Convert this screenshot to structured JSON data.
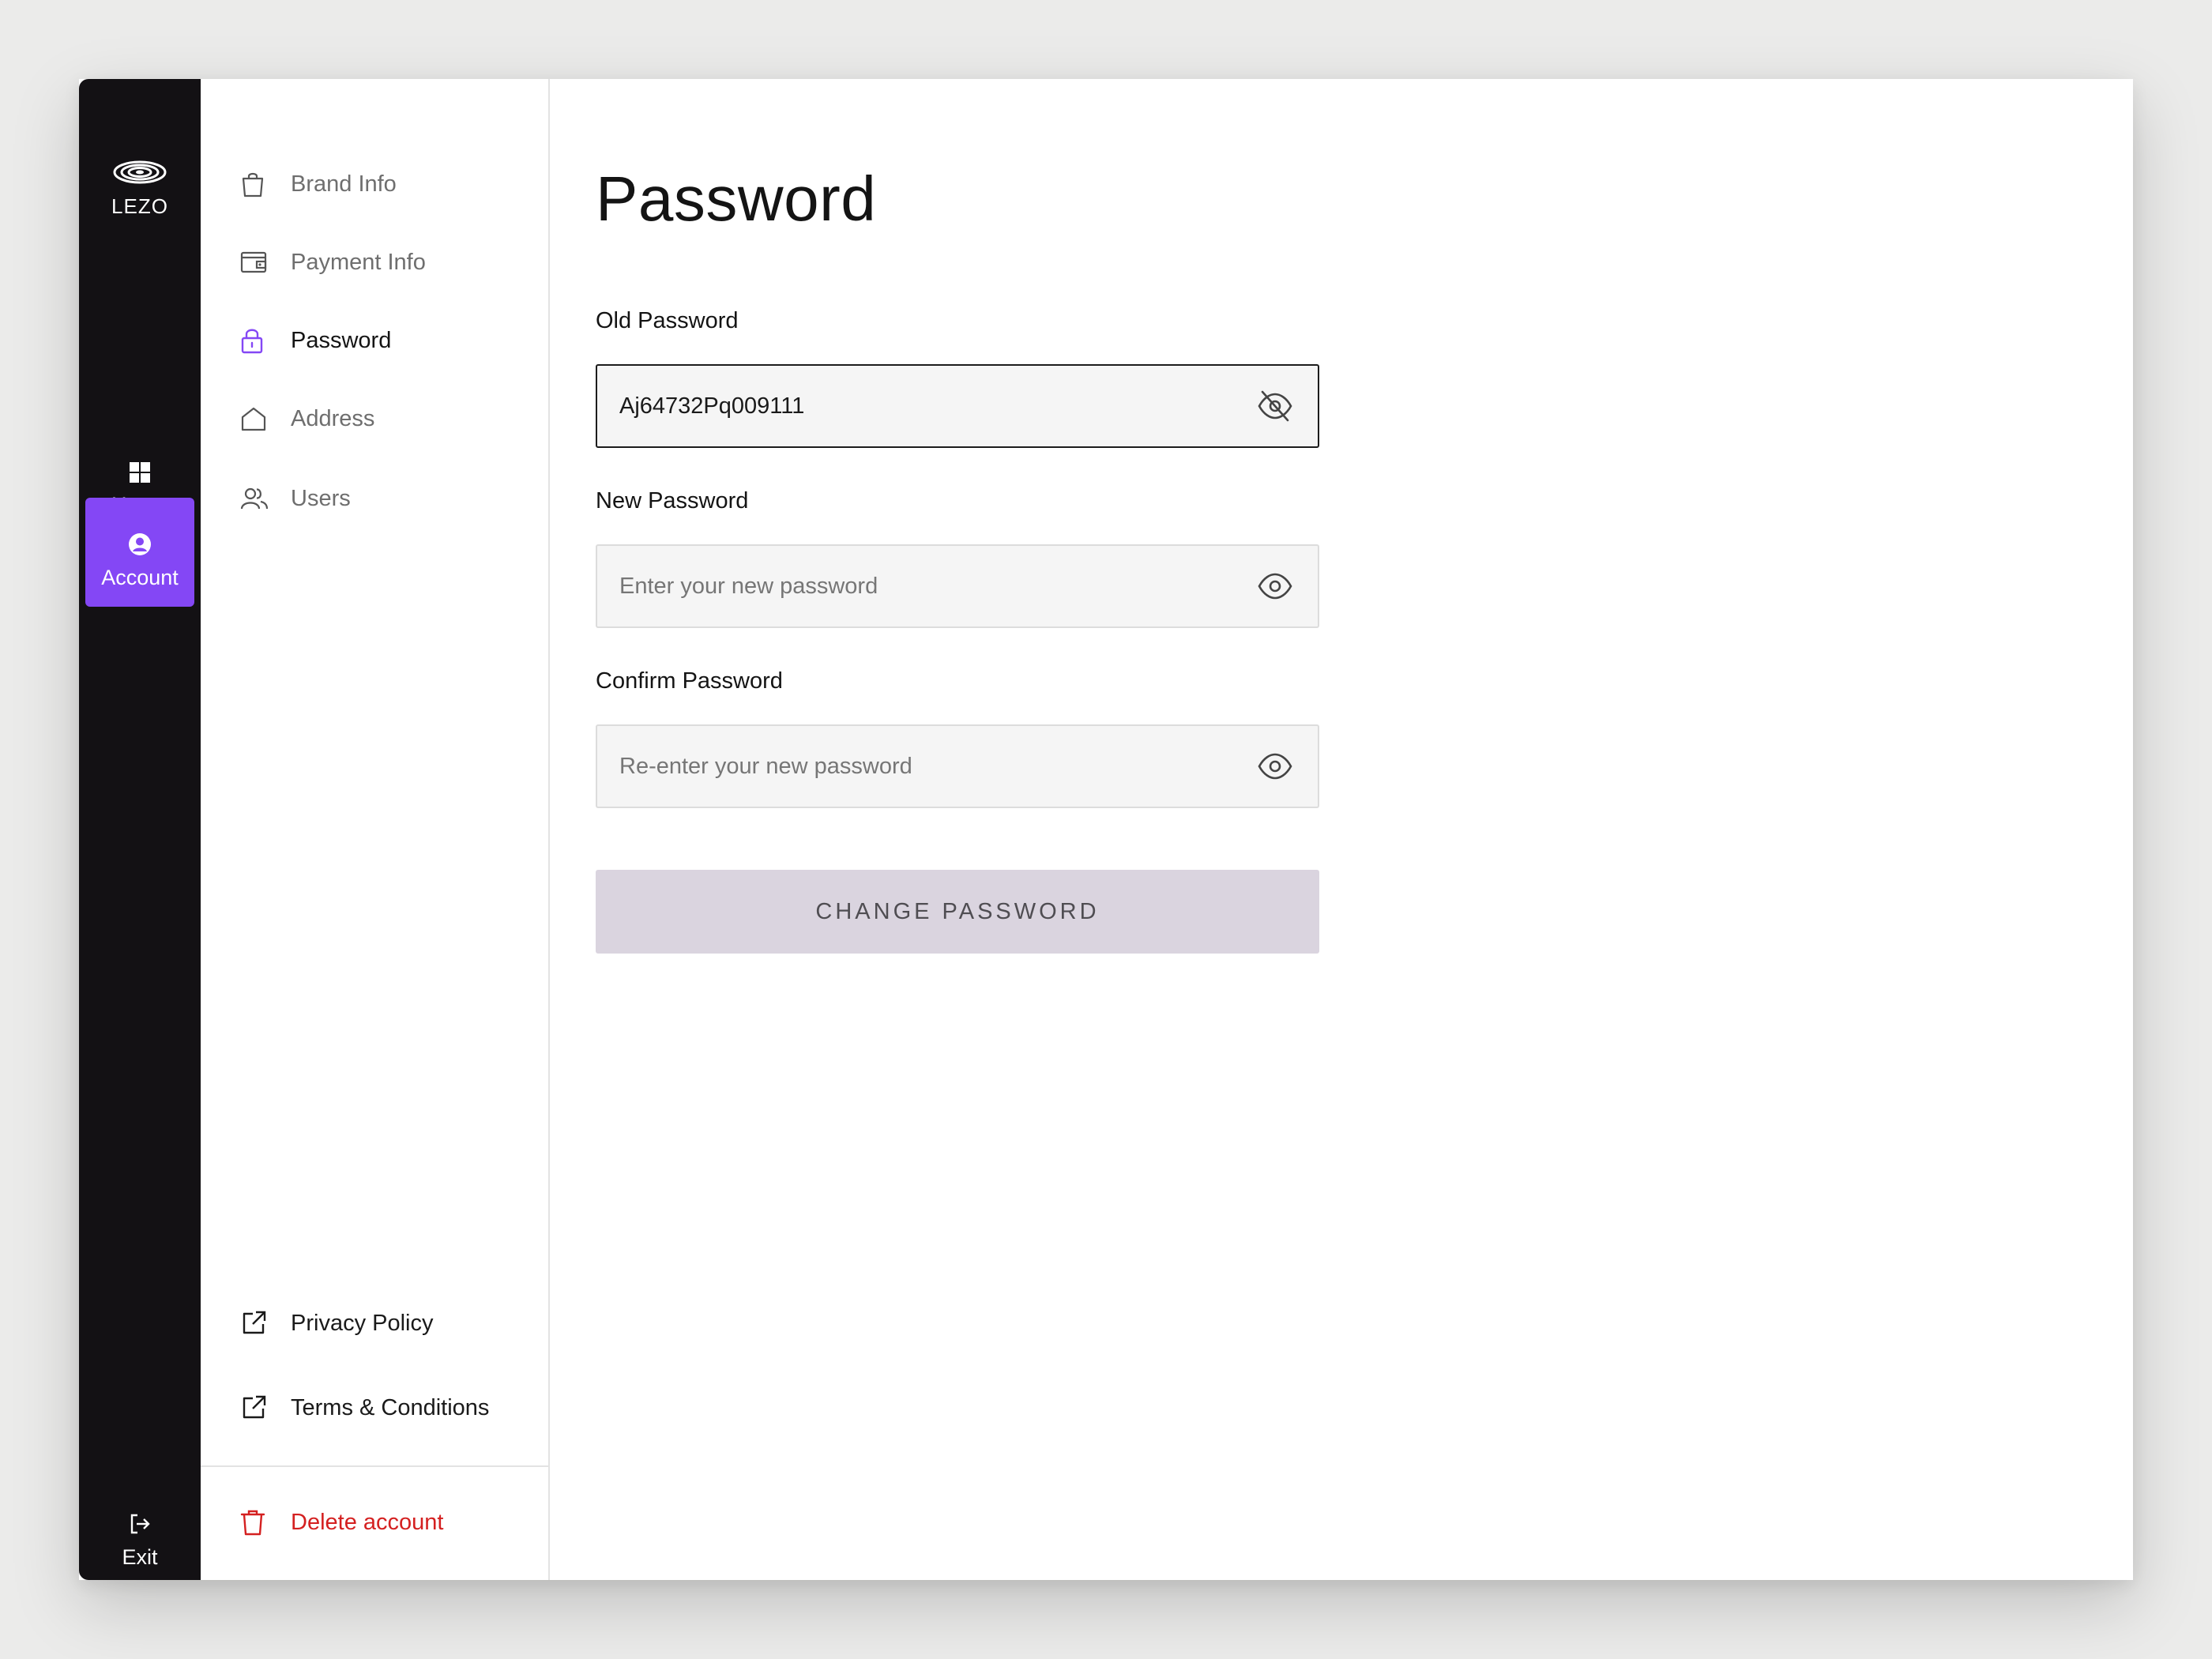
{
  "brand": {
    "name": "LEZO"
  },
  "rail": {
    "home_label": "Home",
    "account_label": "Account",
    "exit_label": "Exit"
  },
  "subnav": {
    "items": [
      {
        "label": "Brand Info",
        "icon": "shopping-bag-icon"
      },
      {
        "label": "Payment Info",
        "icon": "wallet-icon"
      },
      {
        "label": "Password",
        "icon": "lock-icon",
        "active": true
      },
      {
        "label": "Address",
        "icon": "home-outline-icon"
      },
      {
        "label": "Users",
        "icon": "users-icon"
      }
    ],
    "privacy_label": "Privacy Policy",
    "terms_label": "Terms & Conditions",
    "delete_label": "Delete account"
  },
  "main": {
    "title": "Password",
    "old_password": {
      "label": "Old Password",
      "value": "Aj64732Pq009111",
      "placeholder": ""
    },
    "new_password": {
      "label": "New Password",
      "value": "",
      "placeholder": "Enter your new password"
    },
    "confirm_password": {
      "label": "Confirm Password",
      "value": "",
      "placeholder": "Re-enter your new password"
    },
    "submit_label": "CHANGE PASSWORD"
  },
  "colors": {
    "accent": "#8447f5",
    "rail": "#131114",
    "danger": "#d42020",
    "button_disabled": "#dad4df"
  }
}
